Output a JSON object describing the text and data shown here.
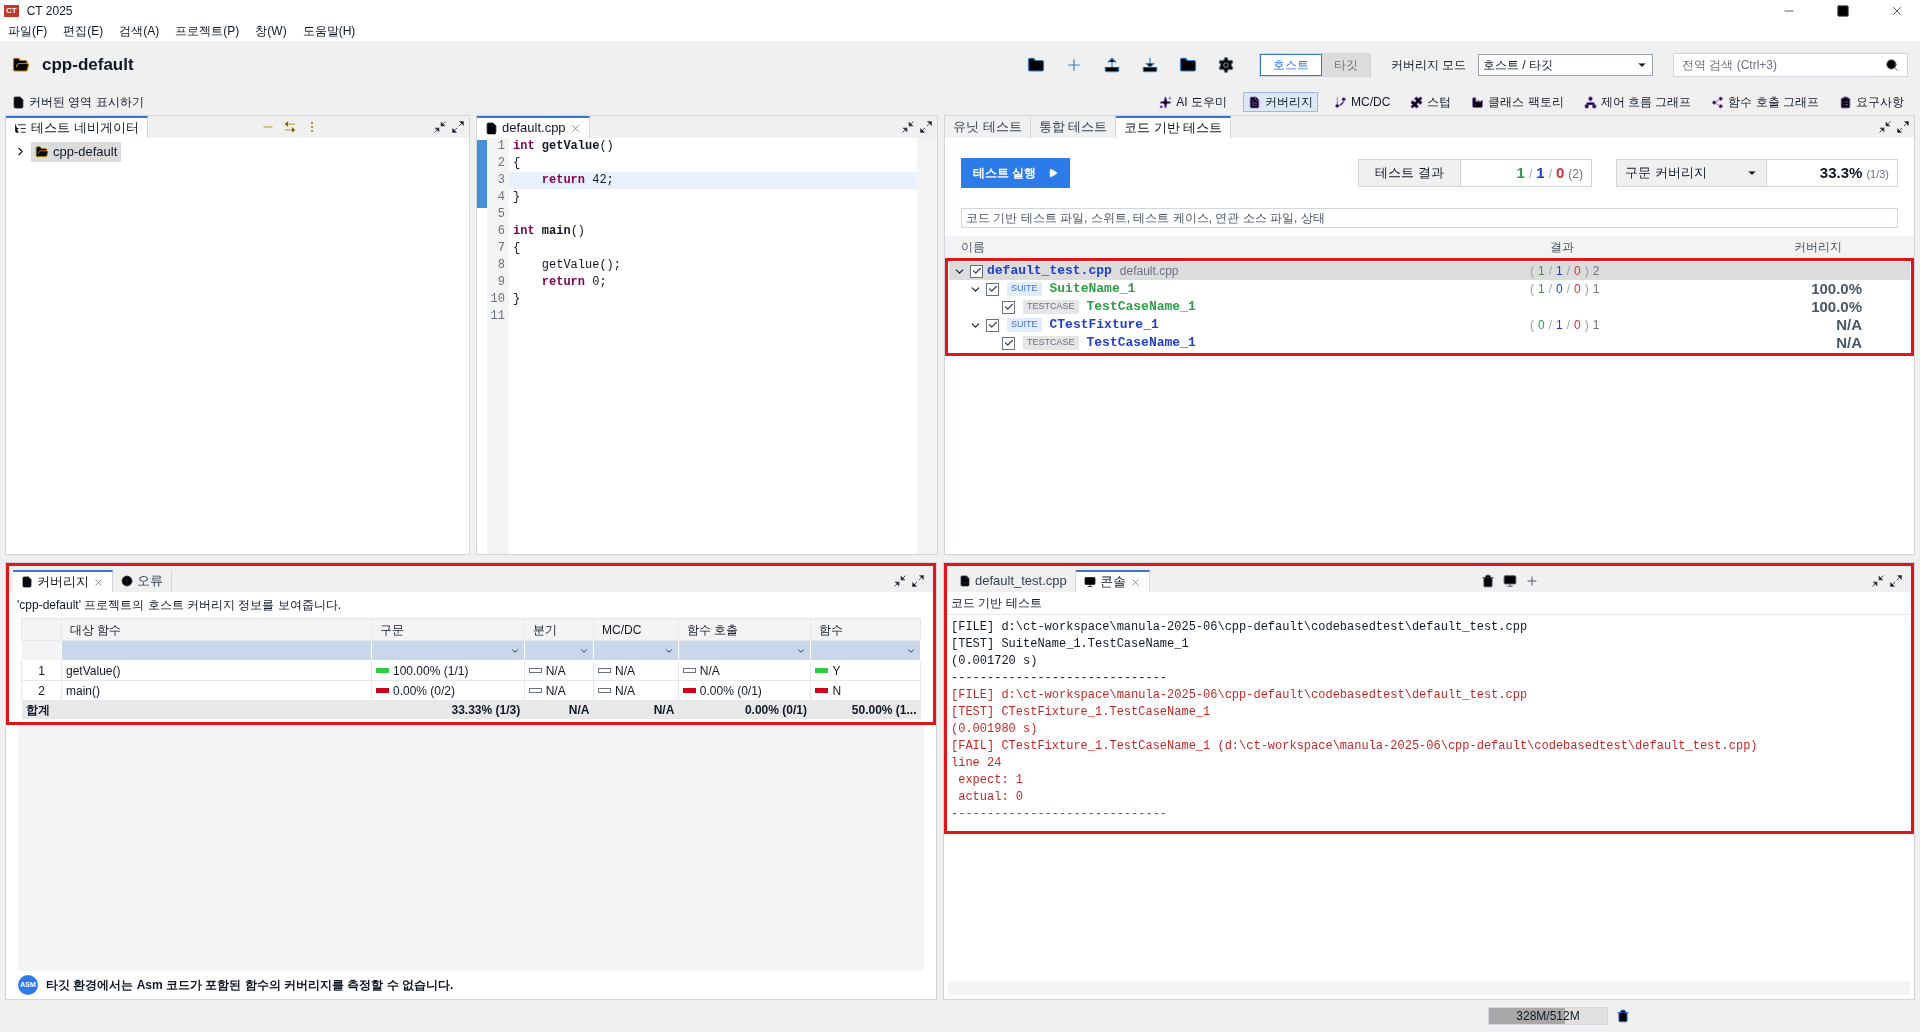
{
  "window": {
    "title": "CT 2025",
    "app_badge": "CT"
  },
  "menu": [
    "파일(F)",
    "편집(E)",
    "검색(A)",
    "프로젝트(P)",
    "창(W)",
    "도움말(H)"
  ],
  "main_toolbar": {
    "project": "cpp-default",
    "modes": [
      {
        "label": "호스트",
        "selected": true
      },
      {
        "label": "타깃",
        "selected": false
      }
    ],
    "coverage_mode_label": "커버리지 모드",
    "coverage_mode_value": "호스트 / 타깃",
    "search_placeholder": "전역 검색 (Ctrl+3)"
  },
  "secondary_toolbar": {
    "left": "커버된 영역 표시하기",
    "items": [
      {
        "label": "AI 도우미",
        "selected": false
      },
      {
        "label": "커버리지",
        "selected": true
      },
      {
        "label": "MC/DC",
        "selected": false
      },
      {
        "label": "스텁",
        "selected": false
      },
      {
        "label": "클래스 팩토리",
        "selected": false
      },
      {
        "label": "제어 흐름 그래프",
        "selected": false
      },
      {
        "label": "함수 호출 그래프",
        "selected": false
      },
      {
        "label": "요구사항",
        "selected": false
      }
    ]
  },
  "navigator": {
    "title": "테스트 네비게이터",
    "items": [
      {
        "label": "cpp-default",
        "expanded": false,
        "selected": true
      }
    ]
  },
  "editor": {
    "tab": "default.cpp",
    "lines": [
      {
        "number": "1",
        "current": false,
        "segments": [
          {
            "text": "int ",
            "kind": "keyword"
          },
          {
            "text": "getValue",
            "kind": "function"
          },
          {
            "text": "()",
            "kind": "plain"
          }
        ]
      },
      {
        "number": "2",
        "current": false,
        "segments": [
          {
            "text": "{",
            "kind": "plain"
          }
        ]
      },
      {
        "number": "3",
        "current": true,
        "segments": [
          {
            "text": "    return",
            "kind": "keyword"
          },
          {
            "text": " 42;",
            "kind": "plain"
          }
        ]
      },
      {
        "number": "4",
        "current": false,
        "segments": [
          {
            "text": "}",
            "kind": "plain"
          }
        ]
      },
      {
        "number": "5",
        "current": false
      },
      {
        "number": "6",
        "current": false,
        "segments": [
          {
            "text": "int ",
            "kind": "keyword"
          },
          {
            "text": "main",
            "kind": "function"
          },
          {
            "text": "()",
            "kind": "plain"
          }
        ]
      },
      {
        "number": "7",
        "current": false,
        "segments": [
          {
            "text": "{",
            "kind": "plain"
          }
        ]
      },
      {
        "number": "8",
        "current": false,
        "segments": [
          {
            "text": "    getValue();",
            "kind": "plain"
          }
        ]
      },
      {
        "number": "9",
        "current": false,
        "segments": [
          {
            "text": "    return",
            "kind": "keyword"
          },
          {
            "text": " 0;",
            "kind": "plain"
          }
        ]
      },
      {
        "number": "10",
        "current": false,
        "segments": [
          {
            "text": "}",
            "kind": "plain"
          }
        ]
      },
      {
        "number": "11",
        "current": false
      }
    ]
  },
  "test_panel": {
    "tabs": [
      {
        "label": "유닛 테스트",
        "selected": false
      },
      {
        "label": "통합 테스트",
        "selected": false
      },
      {
        "label": "코드 기반 테스트",
        "selected": true
      }
    ],
    "run_button": "테스트 실행",
    "result_label": "테스트 결과",
    "result": [
      {
        "kind": "passed",
        "text": "1"
      },
      {
        "kind": "separator",
        "text": "/"
      },
      {
        "kind": "failed",
        "text": "1"
      },
      {
        "kind": "separator",
        "text": "/"
      },
      {
        "kind": "error",
        "text": "0"
      },
      {
        "kind": "total",
        "text": "(2)"
      }
    ],
    "coverage_select": "구문 커버리지",
    "coverage_value": "33.3%",
    "coverage_detail": "(1/3)",
    "filter_placeholder": "코드 기반 테스트 파일, 스위트, 테스트 케이스, 연관 소스 파일, 상태",
    "columns": [
      "이름",
      "결과",
      "커버리지"
    ],
    "highlighted": true,
    "tree": [
      {
        "kind": "file",
        "name": "default_test.cpp",
        "source": "default.cpp",
        "passed": false,
        "checked": true,
        "expanded": true,
        "selected": true,
        "result": [
          {
            "kind": "separator",
            "text": "("
          },
          {
            "kind": "passed",
            "text": "1"
          },
          {
            "kind": "separator",
            "text": "/"
          },
          {
            "kind": "failed",
            "text": "1"
          },
          {
            "kind": "separator",
            "text": "/"
          },
          {
            "kind": "error",
            "text": "0"
          },
          {
            "kind": "separator",
            "text": ")"
          },
          {
            "kind": "total",
            "text": "2"
          }
        ],
        "children": [
          {
            "kind": "suite",
            "tag": "SUITE",
            "name": "SuiteName_1",
            "passed": true,
            "checked": true,
            "expanded": true,
            "selected": false,
            "result": [
              {
                "kind": "separator",
                "text": "("
              },
              {
                "kind": "passed",
                "text": "1"
              },
              {
                "kind": "separator",
                "text": "/"
              },
              {
                "kind": "failed",
                "text": "0"
              },
              {
                "kind": "separator",
                "text": "/"
              },
              {
                "kind": "error",
                "text": "0"
              },
              {
                "kind": "separator",
                "text": ")"
              },
              {
                "kind": "total",
                "text": "1"
              }
            ],
            "coverage": "100.0%",
            "children": [
              {
                "kind": "testcase",
                "tag": "TESTCASE",
                "name": "TestCaseName_1",
                "passed": true,
                "checked": true,
                "selected": false,
                "coverage": "100.0%"
              }
            ]
          },
          {
            "kind": "suite",
            "tag": "SUITE",
            "name": "CTestFixture_1",
            "passed": false,
            "checked": true,
            "expanded": true,
            "selected": false,
            "result": [
              {
                "kind": "separator",
                "text": "("
              },
              {
                "kind": "passed",
                "text": "0"
              },
              {
                "kind": "separator",
                "text": "/"
              },
              {
                "kind": "failed",
                "text": "1"
              },
              {
                "kind": "separator",
                "text": "/"
              },
              {
                "kind": "error",
                "text": "0"
              },
              {
                "kind": "separator",
                "text": ")"
              },
              {
                "kind": "total",
                "text": "1"
              }
            ],
            "coverage": "N/A",
            "children": [
              {
                "kind": "testcase",
                "tag": "TESTCASE",
                "name": "TestCaseName_1",
                "passed": false,
                "checked": true,
                "selected": false,
                "coverage": "N/A"
              }
            ]
          }
        ]
      }
    ]
  },
  "coverage_panel": {
    "tabs": [
      {
        "label": "커버리지",
        "selected": true
      },
      {
        "label": "오류",
        "selected": false
      }
    ],
    "highlighted": true,
    "description": "'cpp-default' 프로젝트의 호스트 커버리지 정보를 보여줍니다.",
    "columns": [
      "",
      "대상 함수",
      "구문",
      "분기",
      "MC/DC",
      "함수 호출",
      "함수"
    ],
    "rows": [
      {
        "cells": [
          {
            "kind": "index",
            "text": "1"
          },
          {
            "kind": "name",
            "text": "getValue()"
          },
          {
            "kind": "covered",
            "text": "100.00% (1/1)"
          },
          {
            "kind": "na",
            "text": "N/A"
          },
          {
            "kind": "na",
            "text": "N/A"
          },
          {
            "kind": "na",
            "text": "N/A"
          },
          {
            "kind": "covered",
            "text": "Y"
          }
        ]
      },
      {
        "cells": [
          {
            "kind": "index",
            "text": "2"
          },
          {
            "kind": "name",
            "text": "main()"
          },
          {
            "kind": "uncovered",
            "text": "0.00% (0/2)"
          },
          {
            "kind": "na",
            "text": "N/A"
          },
          {
            "kind": "na",
            "text": "N/A"
          },
          {
            "kind": "uncovered",
            "text": "0.00% (0/1)"
          },
          {
            "kind": "uncovered",
            "text": "N"
          }
        ]
      }
    ],
    "total": {
      "cells": [
        "합계",
        "",
        "33.33% (1/3)",
        "N/A",
        "N/A",
        "0.00% (0/1)",
        "50.00% (1..."
      ]
    },
    "footer_badge": "ASM",
    "footer": "타깃 환경에서는 Asm 코드가 포함된 함수의 커버리지를 측정할 수 없습니다."
  },
  "console": {
    "tabs": [
      {
        "label": "default_test.cpp",
        "selected": false
      },
      {
        "label": "콘솔",
        "selected": true
      }
    ],
    "highlighted": true,
    "title": "코드 기반 테스트",
    "lines": [
      {
        "kind": "normal",
        "text": "[FILE] d:\\ct-workspace\\manula-2025-06\\cpp-default\\codebasedtest\\default_test.cpp"
      },
      {
        "kind": "normal",
        "text": "[TEST] SuiteName_1.TestCaseName_1"
      },
      {
        "kind": "normal",
        "text": "(0.001720 s)"
      },
      {
        "kind": "normal",
        "text": "------------------------------"
      },
      {
        "kind": "error",
        "text": "[FILE] d:\\ct-workspace\\manula-2025-06\\cpp-default\\codebasedtest\\default_test.cpp"
      },
      {
        "kind": "error",
        "text": "[TEST] CTestFixture_1.TestCaseName_1"
      },
      {
        "kind": "error",
        "text": "(0.001980 s)"
      },
      {
        "kind": "error",
        "text": "[FAIL] CTestFixture_1.TestCaseName_1 (d:\\ct-workspace\\manula-2025-06\\cpp-default\\codebasedtest\\default_test.cpp)"
      },
      {
        "kind": "error",
        "text": "line 24"
      },
      {
        "kind": "error",
        "text": " expect: 1"
      },
      {
        "kind": "error",
        "text": " actual: 0"
      },
      {
        "kind": "error",
        "text": "------------------------------"
      }
    ]
  },
  "status_bar": {
    "memory": "328M/512M",
    "level": 0.64
  }
}
